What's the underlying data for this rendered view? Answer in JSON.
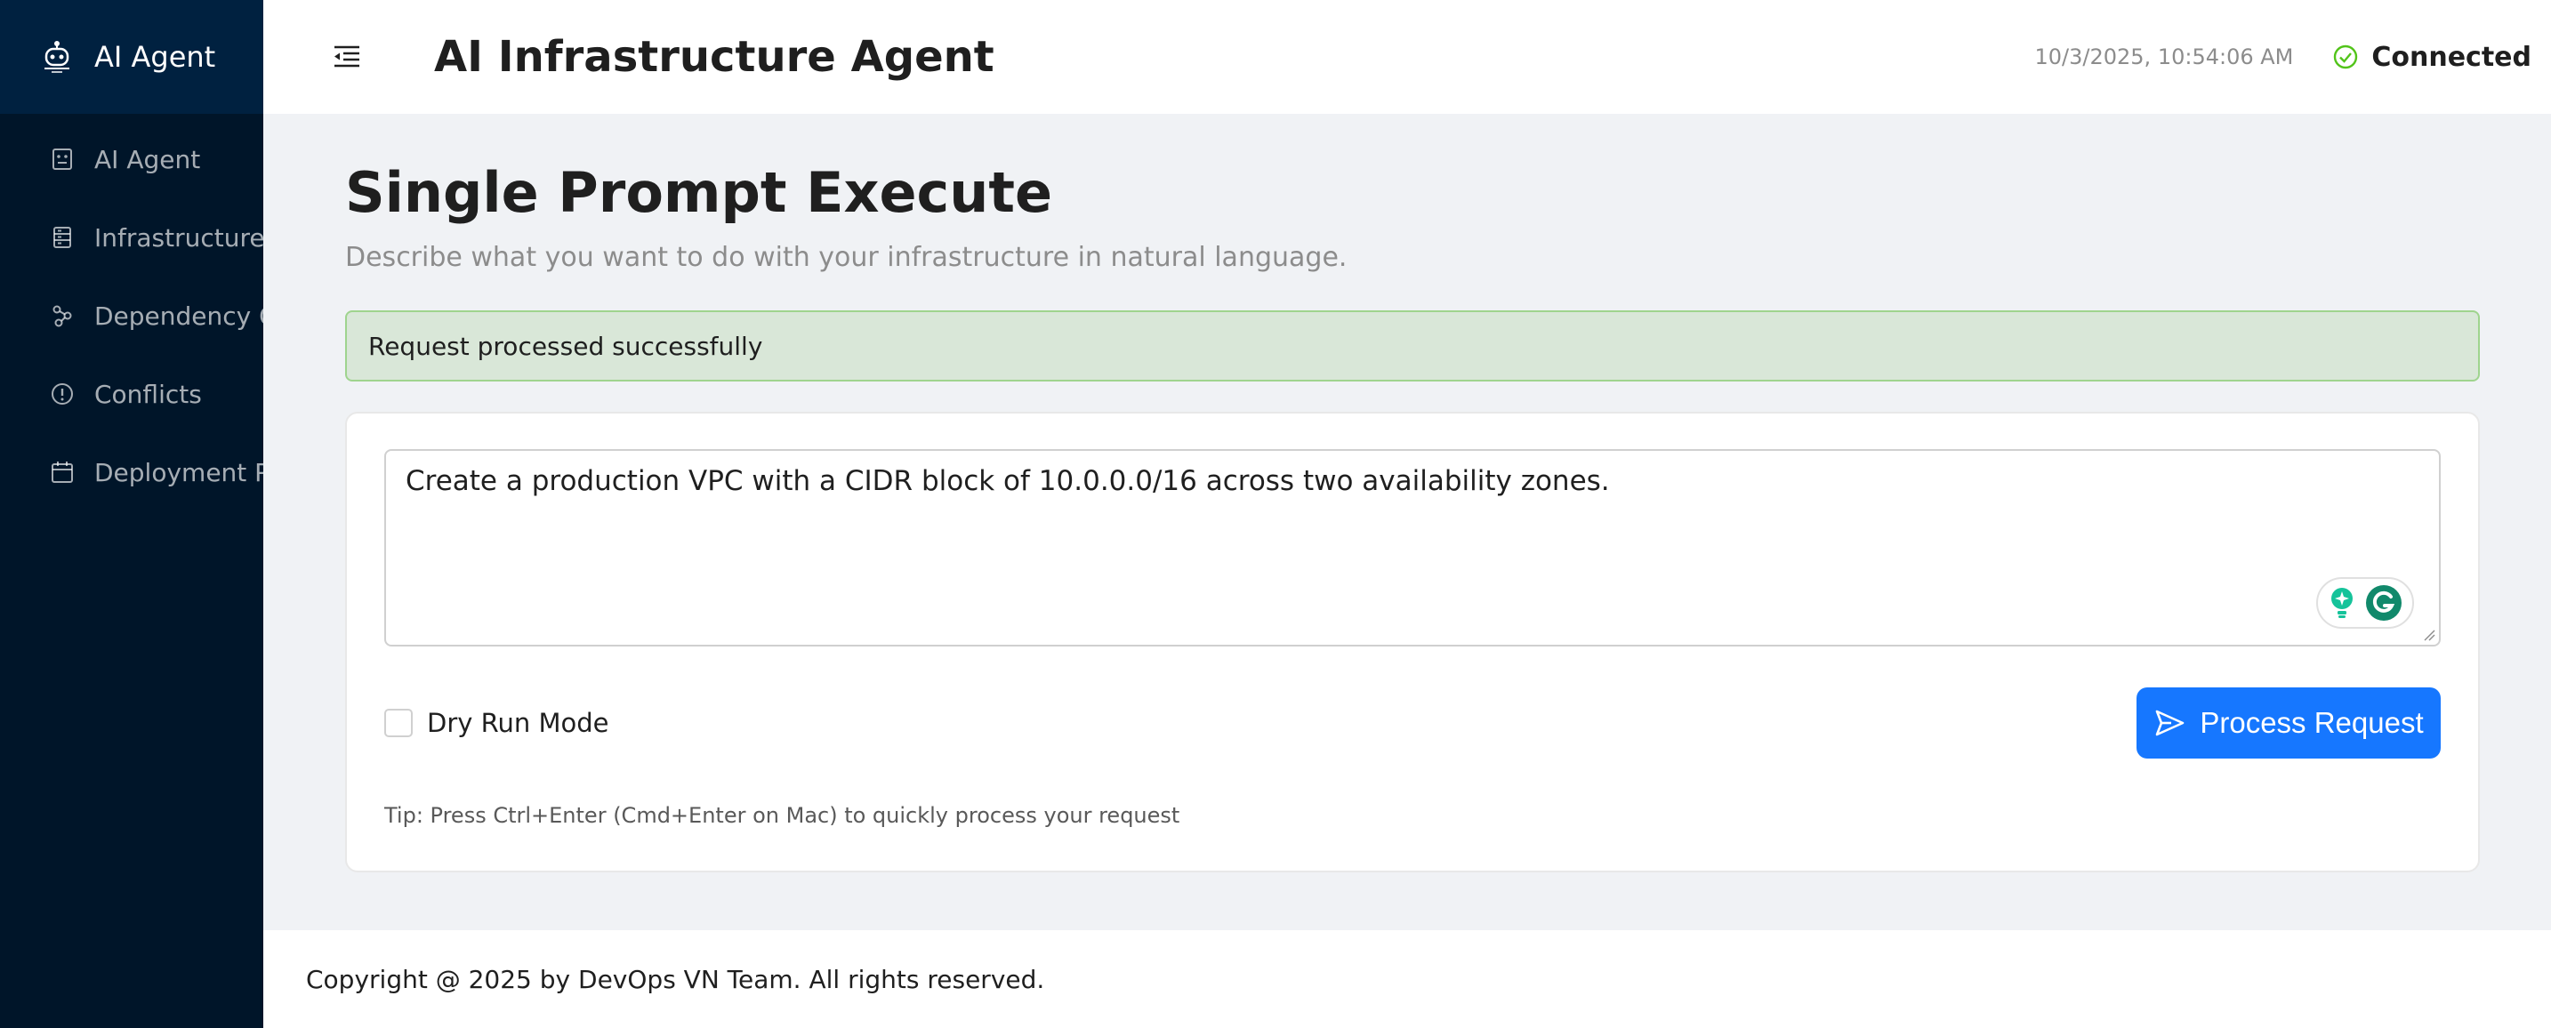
{
  "sidebar": {
    "logo_text": "AI Agent",
    "items": [
      {
        "label": "AI Agent",
        "icon": "robot-icon"
      },
      {
        "label": "Infrastructure State",
        "icon": "server-icon"
      },
      {
        "label": "Dependency Graph",
        "icon": "graph-icon"
      },
      {
        "label": "Conflicts",
        "icon": "exclamation-icon"
      },
      {
        "label": "Deployment Plan",
        "icon": "calendar-icon"
      }
    ]
  },
  "header": {
    "title": "AI Infrastructure Agent",
    "timestamp": "10/3/2025, 10:54:06 AM",
    "status": "Connected",
    "status_color": "#52c41a"
  },
  "page": {
    "title": "Single Prompt Execute",
    "subtitle": "Describe what you want to do with your infrastructure in natural language."
  },
  "alert": {
    "message": "Request processed successfully"
  },
  "form": {
    "prompt_value": "Create a production VPC with a CIDR block of 10.0.0.0/16 across two availability zones.",
    "dry_run_label": "Dry Run Mode",
    "dry_run_checked": false,
    "submit_label": "Process Request",
    "tip": "Tip: Press Ctrl+Enter (Cmd+Enter on Mac) to quickly process your request"
  },
  "footer": {
    "text": "Copyright @ 2025 by DevOps VN Team. All rights reserved."
  },
  "colors": {
    "sidebar_bg": "#001529",
    "primary": "#1677ff",
    "success_bg": "#d9e7d8",
    "grammarly": "#15c39a"
  }
}
